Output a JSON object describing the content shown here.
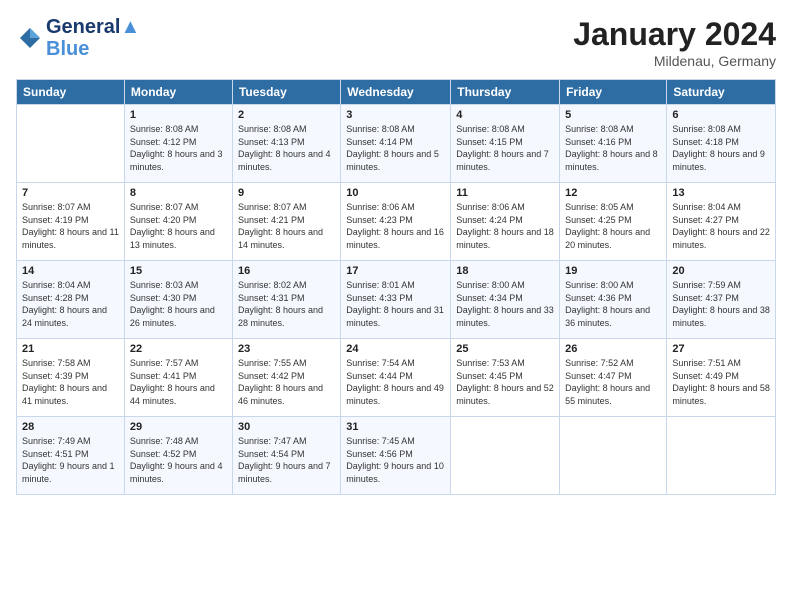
{
  "header": {
    "logo_line1": "General",
    "logo_line2": "Blue",
    "month": "January 2024",
    "location": "Mildenau, Germany"
  },
  "days_of_week": [
    "Sunday",
    "Monday",
    "Tuesday",
    "Wednesday",
    "Thursday",
    "Friday",
    "Saturday"
  ],
  "weeks": [
    [
      {
        "num": "",
        "sunrise": "",
        "sunset": "",
        "daylight": ""
      },
      {
        "num": "1",
        "sunrise": "Sunrise: 8:08 AM",
        "sunset": "Sunset: 4:12 PM",
        "daylight": "Daylight: 8 hours and 3 minutes."
      },
      {
        "num": "2",
        "sunrise": "Sunrise: 8:08 AM",
        "sunset": "Sunset: 4:13 PM",
        "daylight": "Daylight: 8 hours and 4 minutes."
      },
      {
        "num": "3",
        "sunrise": "Sunrise: 8:08 AM",
        "sunset": "Sunset: 4:14 PM",
        "daylight": "Daylight: 8 hours and 5 minutes."
      },
      {
        "num": "4",
        "sunrise": "Sunrise: 8:08 AM",
        "sunset": "Sunset: 4:15 PM",
        "daylight": "Daylight: 8 hours and 7 minutes."
      },
      {
        "num": "5",
        "sunrise": "Sunrise: 8:08 AM",
        "sunset": "Sunset: 4:16 PM",
        "daylight": "Daylight: 8 hours and 8 minutes."
      },
      {
        "num": "6",
        "sunrise": "Sunrise: 8:08 AM",
        "sunset": "Sunset: 4:18 PM",
        "daylight": "Daylight: 8 hours and 9 minutes."
      }
    ],
    [
      {
        "num": "7",
        "sunrise": "Sunrise: 8:07 AM",
        "sunset": "Sunset: 4:19 PM",
        "daylight": "Daylight: 8 hours and 11 minutes."
      },
      {
        "num": "8",
        "sunrise": "Sunrise: 8:07 AM",
        "sunset": "Sunset: 4:20 PM",
        "daylight": "Daylight: 8 hours and 13 minutes."
      },
      {
        "num": "9",
        "sunrise": "Sunrise: 8:07 AM",
        "sunset": "Sunset: 4:21 PM",
        "daylight": "Daylight: 8 hours and 14 minutes."
      },
      {
        "num": "10",
        "sunrise": "Sunrise: 8:06 AM",
        "sunset": "Sunset: 4:23 PM",
        "daylight": "Daylight: 8 hours and 16 minutes."
      },
      {
        "num": "11",
        "sunrise": "Sunrise: 8:06 AM",
        "sunset": "Sunset: 4:24 PM",
        "daylight": "Daylight: 8 hours and 18 minutes."
      },
      {
        "num": "12",
        "sunrise": "Sunrise: 8:05 AM",
        "sunset": "Sunset: 4:25 PM",
        "daylight": "Daylight: 8 hours and 20 minutes."
      },
      {
        "num": "13",
        "sunrise": "Sunrise: 8:04 AM",
        "sunset": "Sunset: 4:27 PM",
        "daylight": "Daylight: 8 hours and 22 minutes."
      }
    ],
    [
      {
        "num": "14",
        "sunrise": "Sunrise: 8:04 AM",
        "sunset": "Sunset: 4:28 PM",
        "daylight": "Daylight: 8 hours and 24 minutes."
      },
      {
        "num": "15",
        "sunrise": "Sunrise: 8:03 AM",
        "sunset": "Sunset: 4:30 PM",
        "daylight": "Daylight: 8 hours and 26 minutes."
      },
      {
        "num": "16",
        "sunrise": "Sunrise: 8:02 AM",
        "sunset": "Sunset: 4:31 PM",
        "daylight": "Daylight: 8 hours and 28 minutes."
      },
      {
        "num": "17",
        "sunrise": "Sunrise: 8:01 AM",
        "sunset": "Sunset: 4:33 PM",
        "daylight": "Daylight: 8 hours and 31 minutes."
      },
      {
        "num": "18",
        "sunrise": "Sunrise: 8:00 AM",
        "sunset": "Sunset: 4:34 PM",
        "daylight": "Daylight: 8 hours and 33 minutes."
      },
      {
        "num": "19",
        "sunrise": "Sunrise: 8:00 AM",
        "sunset": "Sunset: 4:36 PM",
        "daylight": "Daylight: 8 hours and 36 minutes."
      },
      {
        "num": "20",
        "sunrise": "Sunrise: 7:59 AM",
        "sunset": "Sunset: 4:37 PM",
        "daylight": "Daylight: 8 hours and 38 minutes."
      }
    ],
    [
      {
        "num": "21",
        "sunrise": "Sunrise: 7:58 AM",
        "sunset": "Sunset: 4:39 PM",
        "daylight": "Daylight: 8 hours and 41 minutes."
      },
      {
        "num": "22",
        "sunrise": "Sunrise: 7:57 AM",
        "sunset": "Sunset: 4:41 PM",
        "daylight": "Daylight: 8 hours and 44 minutes."
      },
      {
        "num": "23",
        "sunrise": "Sunrise: 7:55 AM",
        "sunset": "Sunset: 4:42 PM",
        "daylight": "Daylight: 8 hours and 46 minutes."
      },
      {
        "num": "24",
        "sunrise": "Sunrise: 7:54 AM",
        "sunset": "Sunset: 4:44 PM",
        "daylight": "Daylight: 8 hours and 49 minutes."
      },
      {
        "num": "25",
        "sunrise": "Sunrise: 7:53 AM",
        "sunset": "Sunset: 4:45 PM",
        "daylight": "Daylight: 8 hours and 52 minutes."
      },
      {
        "num": "26",
        "sunrise": "Sunrise: 7:52 AM",
        "sunset": "Sunset: 4:47 PM",
        "daylight": "Daylight: 8 hours and 55 minutes."
      },
      {
        "num": "27",
        "sunrise": "Sunrise: 7:51 AM",
        "sunset": "Sunset: 4:49 PM",
        "daylight": "Daylight: 8 hours and 58 minutes."
      }
    ],
    [
      {
        "num": "28",
        "sunrise": "Sunrise: 7:49 AM",
        "sunset": "Sunset: 4:51 PM",
        "daylight": "Daylight: 9 hours and 1 minute."
      },
      {
        "num": "29",
        "sunrise": "Sunrise: 7:48 AM",
        "sunset": "Sunset: 4:52 PM",
        "daylight": "Daylight: 9 hours and 4 minutes."
      },
      {
        "num": "30",
        "sunrise": "Sunrise: 7:47 AM",
        "sunset": "Sunset: 4:54 PM",
        "daylight": "Daylight: 9 hours and 7 minutes."
      },
      {
        "num": "31",
        "sunrise": "Sunrise: 7:45 AM",
        "sunset": "Sunset: 4:56 PM",
        "daylight": "Daylight: 9 hours and 10 minutes."
      },
      {
        "num": "",
        "sunrise": "",
        "sunset": "",
        "daylight": ""
      },
      {
        "num": "",
        "sunrise": "",
        "sunset": "",
        "daylight": ""
      },
      {
        "num": "",
        "sunrise": "",
        "sunset": "",
        "daylight": ""
      }
    ]
  ]
}
